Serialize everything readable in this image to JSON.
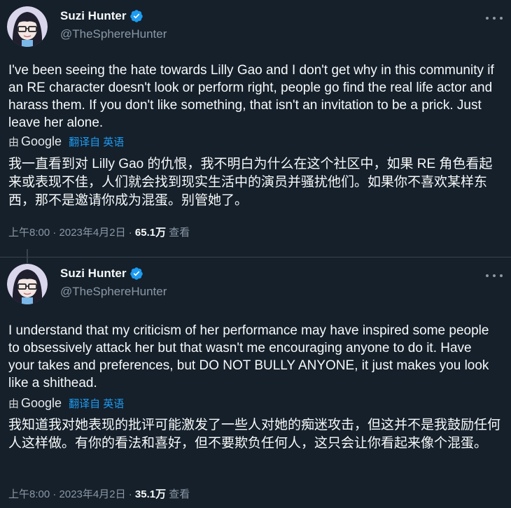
{
  "colors": {
    "background": "#15202b",
    "text_primary": "#f7f9f9",
    "text_secondary": "#8b98a5",
    "accent": "#1d9bf0"
  },
  "tweets": [
    {
      "author_name": "Suzi Hunter",
      "handle": "@TheSphereHunter",
      "text_en": "I've been seeing the hate towards Lilly Gao and I don't get why in this community if an RE character doesn't look or perform right, people go find the real life actor and harass them. If you don't like something, that isn't an invitation to be a prick. Just leave her alone.",
      "translate_by": "由",
      "translate_google": "Google",
      "translate_link": "翻译自 英语",
      "text_zh": "我一直看到对 Lilly Gao 的仇恨，我不明白为什么在这个社区中，如果 RE 角色看起来或表现不佳，人们就会找到现实生活中的演员并骚扰他们。如果你不喜欢某样东西，那不是邀请你成为混蛋。别管她了。",
      "timestamp": "上午8:00 · 2023年4月2日 · ",
      "views_count": "65.1万",
      "views_label": " 查看"
    },
    {
      "author_name": "Suzi Hunter",
      "handle": "@TheSphereHunter",
      "text_en": "I understand that my criticism of her performance may have inspired some people to obsessively attack her but that wasn't me encouraging anyone to do it. Have your takes and preferences, but DO NOT BULLY ANYONE, it just makes you look like a shithead.",
      "translate_by": "由",
      "translate_google": "Google",
      "translate_link": "翻译自 英语",
      "text_zh": "我知道我对她表现的批评可能激发了一些人对她的痴迷攻击，但这并不是我鼓励任何人这样做。有你的看法和喜好，但不要欺负任何人，这只会让你看起来像个混蛋。",
      "timestamp": "上午8:00 · 2023年4月2日 · ",
      "views_count": "35.1万",
      "views_label": " 查看"
    }
  ]
}
